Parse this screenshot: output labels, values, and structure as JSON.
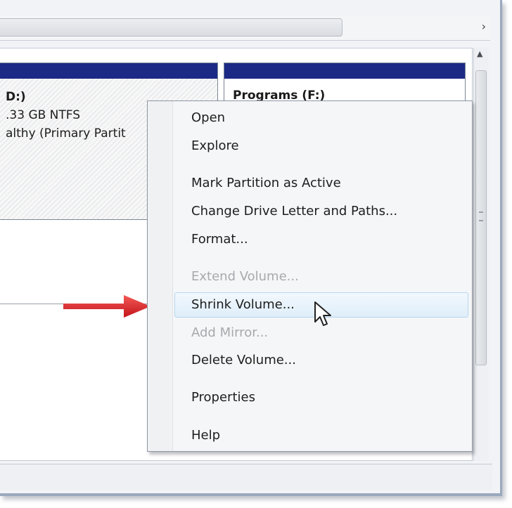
{
  "hscroll": {
    "right_arrow": "›"
  },
  "vscroll": {
    "up_arrow": "▲"
  },
  "disk": {
    "partition_c": {
      "name": "D:)",
      "size": ".33 GB NTFS",
      "status": "althy (Primary Partit"
    },
    "partition_f": {
      "name": "Programs  (F:)"
    }
  },
  "context_menu": {
    "items": [
      {
        "label": "Open",
        "enabled": true
      },
      {
        "label": "Explore",
        "enabled": true
      },
      {
        "label": "Mark Partition as Active",
        "enabled": true
      },
      {
        "label": "Change Drive Letter and Paths...",
        "enabled": true
      },
      {
        "label": "Format...",
        "enabled": true
      },
      {
        "label": "Extend Volume...",
        "enabled": false
      },
      {
        "label": "Shrink Volume...",
        "enabled": true,
        "highlighted": true
      },
      {
        "label": "Add Mirror...",
        "enabled": false
      },
      {
        "label": "Delete Volume...",
        "enabled": true
      },
      {
        "label": "Properties",
        "enabled": true
      },
      {
        "label": "Help",
        "enabled": true
      }
    ]
  },
  "colors": {
    "partition_header": "#1c2a86",
    "arrow": "#e0202a",
    "menu_highlight": "#dfeefa"
  },
  "icons": {
    "arrow": "red-arrow-icon",
    "cursor": "mouse-pointer-icon"
  }
}
